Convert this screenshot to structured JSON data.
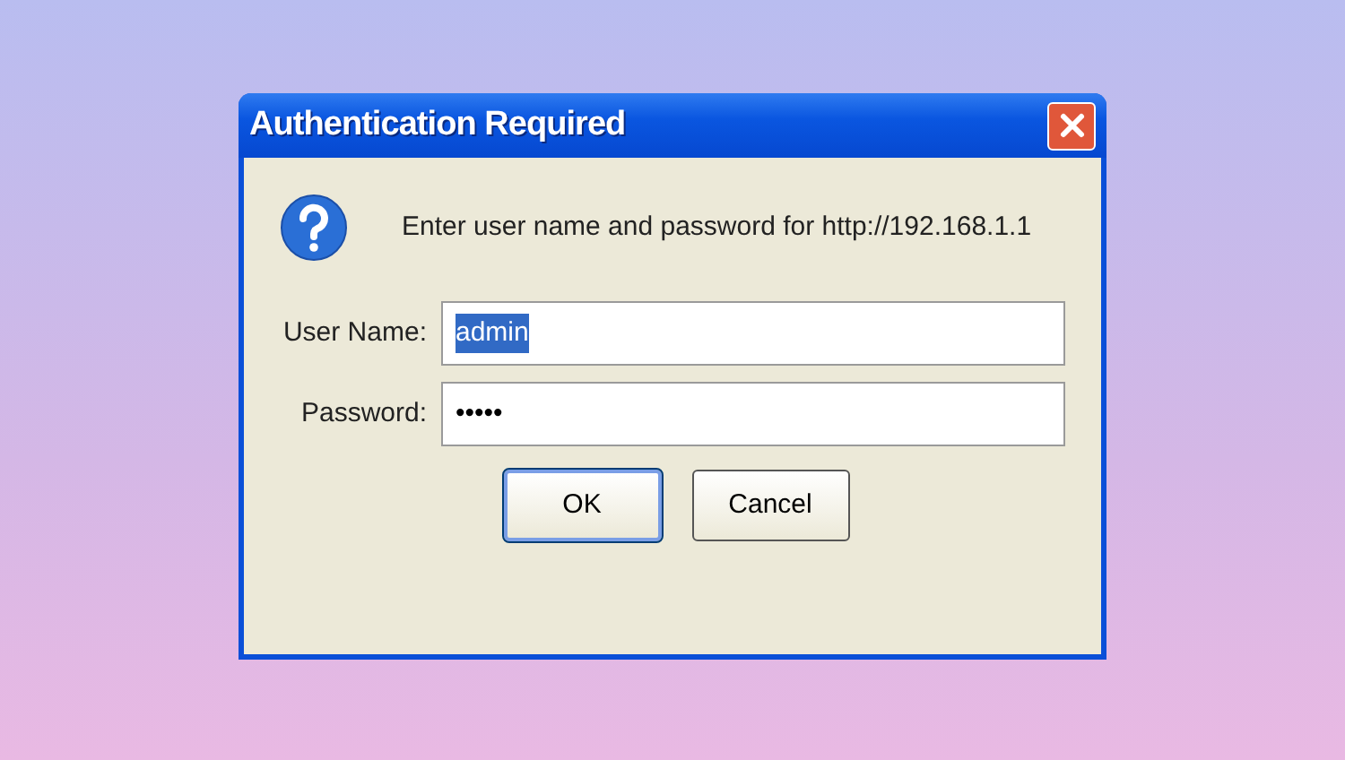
{
  "dialog": {
    "title": "Authentication Required",
    "message": "Enter user name and password for http://192.168.1.1",
    "fields": [
      {
        "label": "User Name:",
        "value": "admin",
        "selected": true
      },
      {
        "label": "Password:",
        "value": "•••••",
        "selected": false
      }
    ],
    "buttons": [
      {
        "label": "OK",
        "default": true
      },
      {
        "label": "Cancel",
        "default": false
      }
    ]
  }
}
